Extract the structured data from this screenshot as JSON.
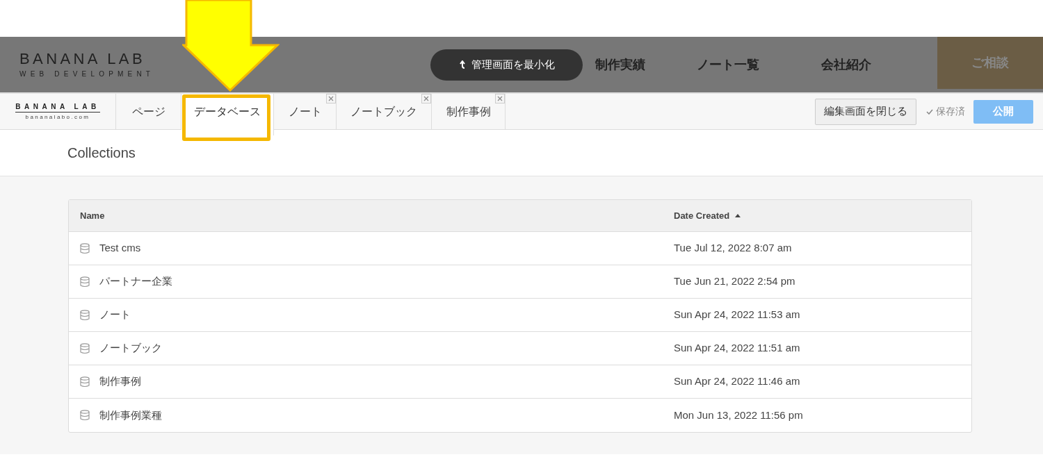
{
  "site_header": {
    "logo": {
      "title": "BANANA LAB",
      "subtitle": "WEB DEVELOPMENT"
    },
    "minimize_button": "管理画面を最小化",
    "nav": [
      "制作実績",
      "ノート一覧",
      "会社紹介"
    ],
    "cta": "ご相談"
  },
  "editor_bar": {
    "logo": {
      "title": "BANANA LAB",
      "subtitle": "bananalabo.com"
    },
    "tabs": [
      {
        "label": "ページ",
        "selected": false,
        "closable": false
      },
      {
        "label": "データベース",
        "selected": true,
        "closable": false
      },
      {
        "label": "ノート",
        "selected": false,
        "closable": true
      },
      {
        "label": "ノートブック",
        "selected": false,
        "closable": true
      },
      {
        "label": "制作事例",
        "selected": false,
        "closable": true
      }
    ],
    "close_editor_button": "編集画面を閉じる",
    "save_status": "保存済",
    "publish_button": "公開"
  },
  "page_title": "Collections",
  "table": {
    "columns": [
      {
        "label": "Name",
        "sorted": false
      },
      {
        "label": "Date Created",
        "sorted": true
      }
    ],
    "rows": [
      {
        "name": "Test cms",
        "date": "Tue Jul 12, 2022 8:07 am"
      },
      {
        "name": "パートナー企業",
        "date": "Tue Jun 21, 2022 2:54 pm"
      },
      {
        "name": "ノート",
        "date": "Sun Apr 24, 2022 11:53 am"
      },
      {
        "name": "ノートブック",
        "date": "Sun Apr 24, 2022 11:51 am"
      },
      {
        "name": "制作事例",
        "date": "Sun Apr 24, 2022 11:46 am"
      },
      {
        "name": "制作事例業種",
        "date": "Mon Jun 13, 2022 11:56 pm"
      }
    ]
  }
}
